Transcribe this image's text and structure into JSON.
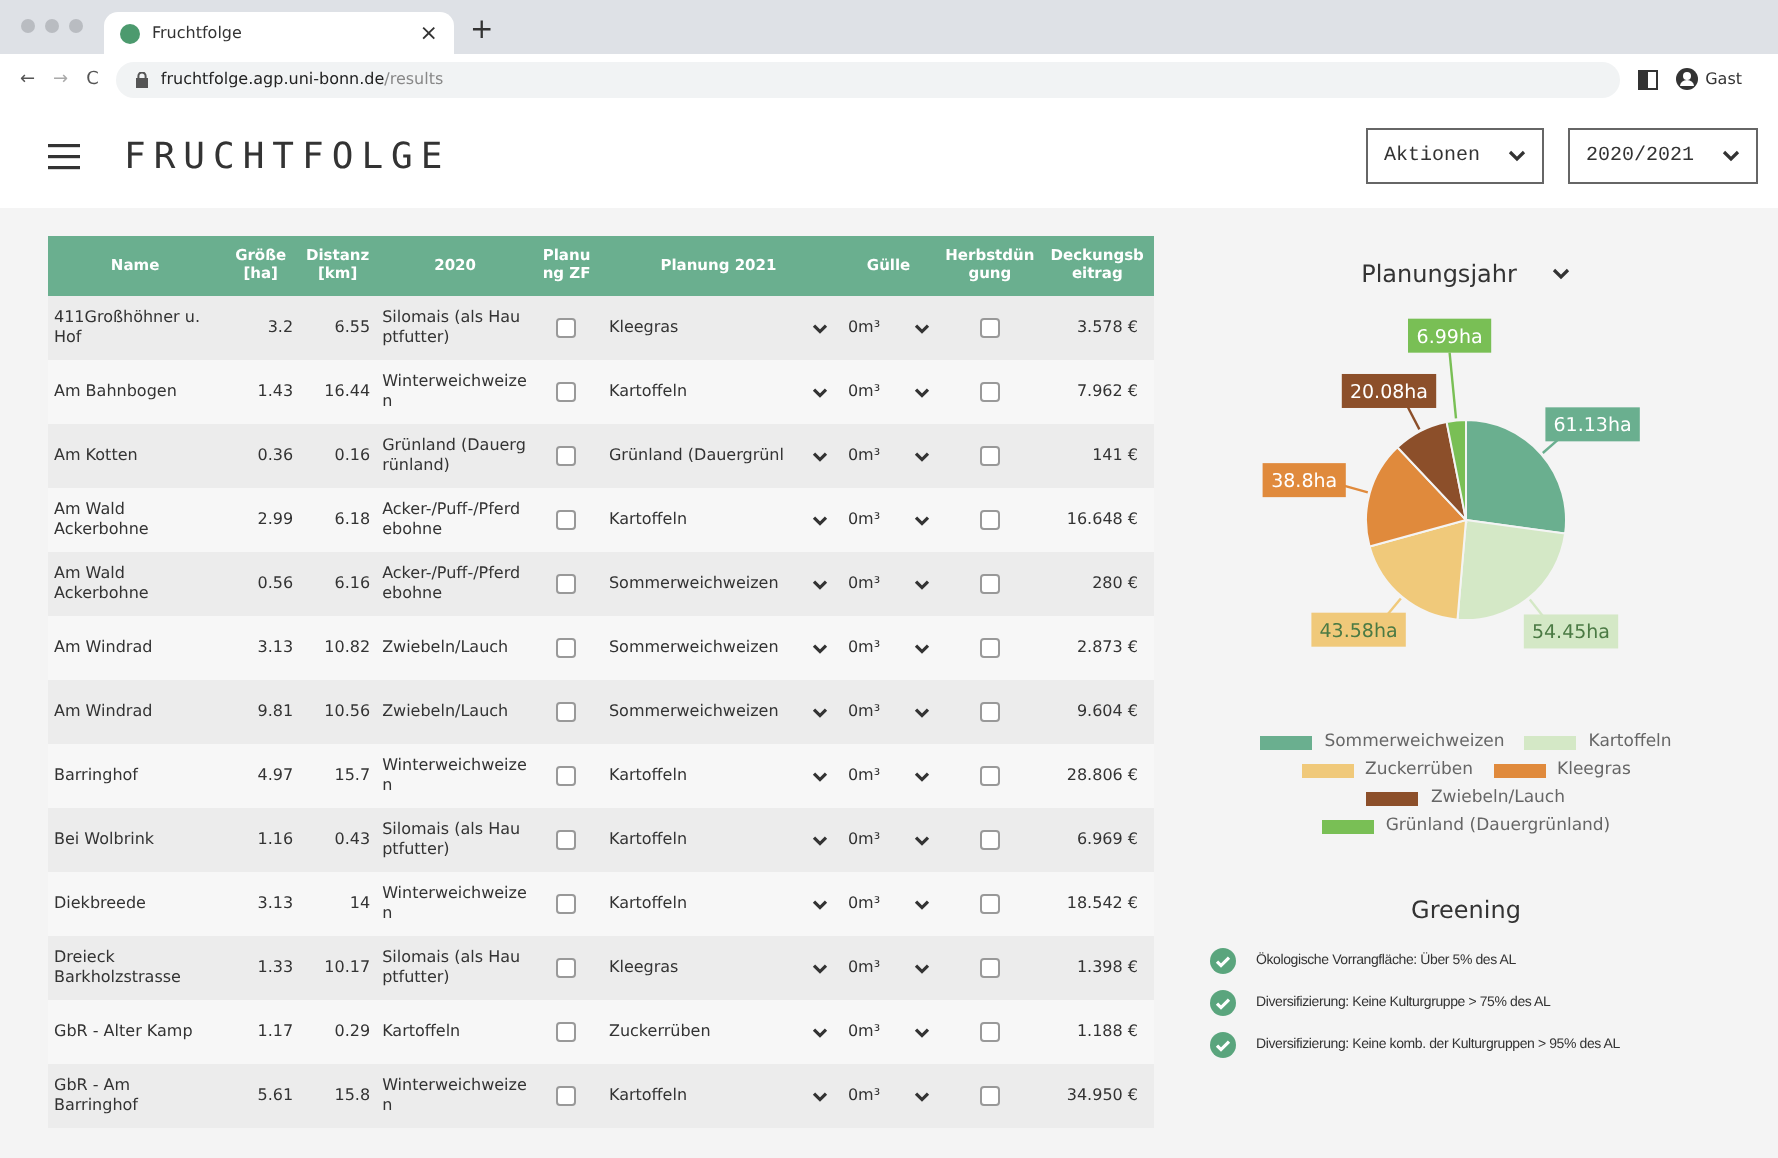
{
  "browser": {
    "close": "×",
    "new_tab": "+",
    "back": "←",
    "forward": "→",
    "reload": "C",
    "tab_title": "Fruchtfolge",
    "url_host": "fruchtfolge.agp.uni-bonn.de",
    "url_path": "/results",
    "profile": "Gast"
  },
  "header": {
    "logo": "FRUCHTFOLGE",
    "actions": "Aktionen",
    "year": "2020/2021"
  },
  "table": {
    "columns": [
      "Name",
      "Größe [ha]",
      "Distanz [km]",
      "2020",
      "Planung ZF",
      "Planung 2021",
      "Gülle",
      "Herbstdüngung",
      "Deckungsbeitrag"
    ],
    "rows": [
      {
        "name": "411Großhöhner u. Hof",
        "size": "3.2",
        "distance": "6.55",
        "crop_2020": "Silomais (als Hauptfutter)",
        "zf": false,
        "plan_2021": "Kleegras",
        "manure": "0m³",
        "autumn": false,
        "margin": "3.578 €"
      },
      {
        "name": "Am Bahnbogen",
        "size": "1.43",
        "distance": "16.44",
        "crop_2020": "Winterweichweizen",
        "zf": false,
        "plan_2021": "Kartoffeln",
        "manure": "0m³",
        "autumn": false,
        "margin": "7.962 €"
      },
      {
        "name": "Am Kotten",
        "size": "0.36",
        "distance": "0.16",
        "crop_2020": "Grünland (Dauergrünland)",
        "zf": false,
        "plan_2021": "Grünland (Dauergrünl",
        "manure": "0m³",
        "autumn": false,
        "margin": "141 €"
      },
      {
        "name": "Am Wald Ackerbohne",
        "size": "2.99",
        "distance": "6.18",
        "crop_2020": "Acker-/Puff-/Pferdebohne",
        "zf": false,
        "plan_2021": "Kartoffeln",
        "manure": "0m³",
        "autumn": false,
        "margin": "16.648 €"
      },
      {
        "name": "Am Wald Ackerbohne",
        "size": "0.56",
        "distance": "6.16",
        "crop_2020": "Acker-/Puff-/Pferdebohne",
        "zf": false,
        "plan_2021": "Sommerweichweizen",
        "manure": "0m³",
        "autumn": false,
        "margin": "280 €"
      },
      {
        "name": "Am Windrad",
        "size": "3.13",
        "distance": "10.82",
        "crop_2020": "Zwiebeln/Lauch",
        "zf": false,
        "plan_2021": "Sommerweichweizen",
        "manure": "0m³",
        "autumn": false,
        "margin": "2.873 €"
      },
      {
        "name": "Am Windrad",
        "size": "9.81",
        "distance": "10.56",
        "crop_2020": "Zwiebeln/Lauch",
        "zf": false,
        "plan_2021": "Sommerweichweizen",
        "manure": "0m³",
        "autumn": false,
        "margin": "9.604 €"
      },
      {
        "name": "Barringhof",
        "size": "4.97",
        "distance": "15.7",
        "crop_2020": "Winterweichweizen",
        "zf": false,
        "plan_2021": "Kartoffeln",
        "manure": "0m³",
        "autumn": false,
        "margin": "28.806 €"
      },
      {
        "name": "Bei Wolbrink",
        "size": "1.16",
        "distance": "0.43",
        "crop_2020": "Silomais (als Hauptfutter)",
        "zf": false,
        "plan_2021": "Kartoffeln",
        "manure": "0m³",
        "autumn": false,
        "margin": "6.969 €"
      },
      {
        "name": "Diekbreede",
        "size": "3.13",
        "distance": "14",
        "crop_2020": "Winterweichweizen",
        "zf": false,
        "plan_2021": "Kartoffeln",
        "manure": "0m³",
        "autumn": false,
        "margin": "18.542 €"
      },
      {
        "name": "Dreieck Barkholzstrasse",
        "size": "1.33",
        "distance": "10.17",
        "crop_2020": "Silomais (als Hauptfutter)",
        "zf": false,
        "plan_2021": "Kleegras",
        "manure": "0m³",
        "autumn": false,
        "margin": "1.398 €"
      },
      {
        "name": "GbR - Alter Kamp",
        "size": "1.17",
        "distance": "0.29",
        "crop_2020": "Kartoffeln",
        "zf": false,
        "plan_2021": "Zuckerrüben",
        "manure": "0m³",
        "autumn": false,
        "margin": "1.188 €"
      },
      {
        "name": "GbR - Am Barringhof",
        "size": "5.61",
        "distance": "15.8",
        "crop_2020": "Winterweichweizen",
        "zf": false,
        "plan_2021": "Kartoffeln",
        "manure": "0m³",
        "autumn": false,
        "margin": "34.950 €"
      }
    ]
  },
  "chart_panel": {
    "selector": "Planungsjahr",
    "chart_data": {
      "type": "pie",
      "categories": [
        "Sommerweichweizen",
        "Kartoffeln",
        "Zuckerrüben",
        "Kleegras",
        "Zwiebeln/Lauch",
        "Grünland (Dauergrünland)"
      ],
      "values": [
        61.13,
        54.45,
        43.58,
        38.8,
        20.08,
        6.99
      ],
      "colors": [
        "#6aaf8f",
        "#d4e8c6",
        "#f0c97a",
        "#e08a3c",
        "#8c4f2a",
        "#79bf55"
      ],
      "value_labels": [
        "61.13ha",
        "54.45ha",
        "43.58ha",
        "38.8ha",
        "20.08ha",
        "6.99ha"
      ]
    }
  },
  "greening": {
    "title": "Greening",
    "items": [
      {
        "text": "Ökologische Vorrangfläche: Über 5% des AL",
        "checked": true
      },
      {
        "text": "Diversifizierung: Keine Kulturgruppe > 75% des AL",
        "checked": true
      },
      {
        "text": "Diversifizierung: Keine komb. der Kulturgruppen > 95% des AL",
        "checked": true
      }
    ]
  }
}
